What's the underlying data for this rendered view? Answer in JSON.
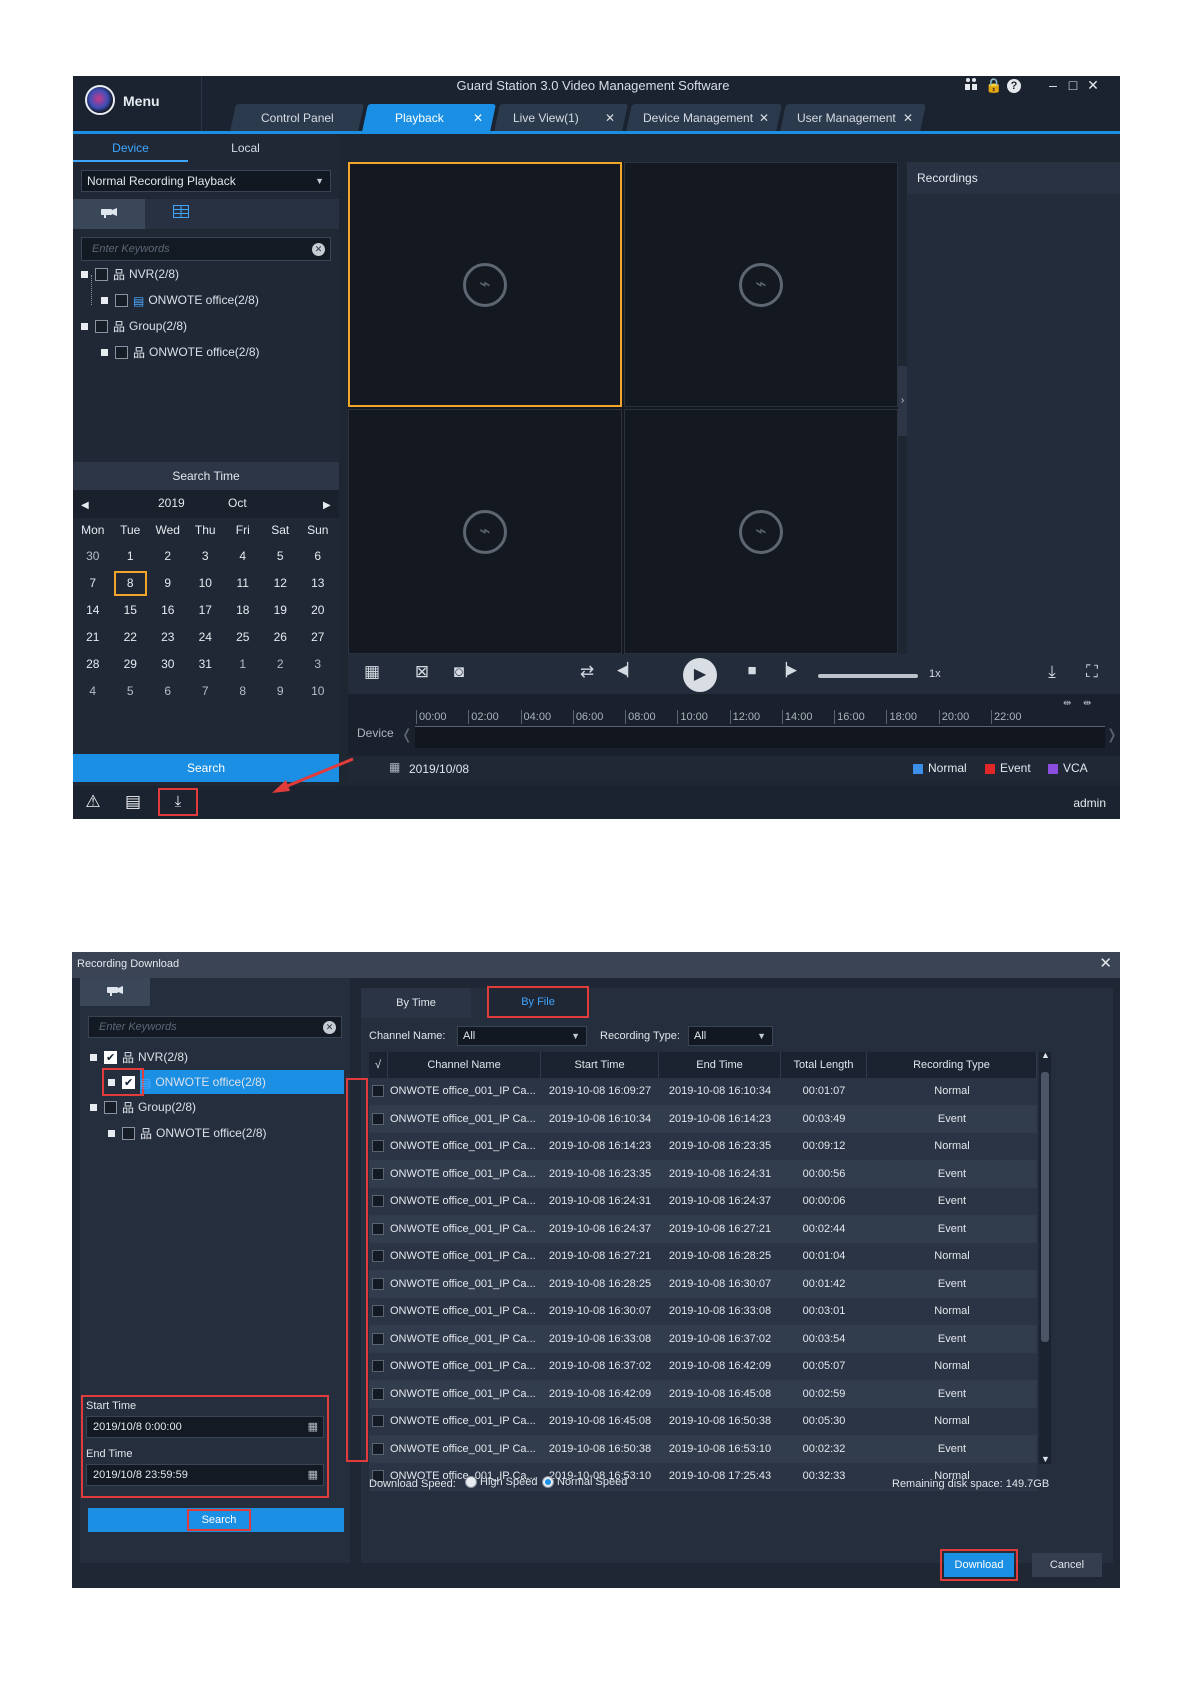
{
  "window1": {
    "menu_label": "Menu",
    "app_title": "Guard Station 3.0 Video Management Software",
    "window_icons": [
      "user-switch-icon",
      "lock-icon",
      "help-icon",
      "minimize-icon",
      "maximize-icon",
      "close-icon"
    ],
    "window_glyphs": {
      "lock": "🔒",
      "help": "?",
      "minimize": "–",
      "maximize": "□",
      "close": "✕"
    },
    "tabs": [
      {
        "label": "Control Panel",
        "closable": false,
        "active": false
      },
      {
        "label": "Playback",
        "closable": true,
        "active": true
      },
      {
        "label": "Live View(1)",
        "closable": true,
        "active": false
      },
      {
        "label": "Device Management",
        "closable": true,
        "active": false
      },
      {
        "label": "User Management",
        "closable": true,
        "active": false
      }
    ],
    "tab_close_glyph": "✕",
    "subtabs": {
      "device": "Device",
      "local": "Local"
    },
    "playback_mode": "Normal Recording Playback",
    "search_placeholder": "Enter Keywords",
    "tree": [
      {
        "label": "NVR(2/8)",
        "level": 0
      },
      {
        "label": "ONWOTE office(2/8)",
        "level": 1
      },
      {
        "label": "Group(2/8)",
        "level": 0
      },
      {
        "label": "ONWOTE office(2/8)",
        "level": 1
      }
    ],
    "search_time_label": "Search Time",
    "calendar": {
      "year": "2019",
      "month": "Oct",
      "weekdays": [
        "Mon",
        "Tue",
        "Wed",
        "Thu",
        "Fri",
        "Sat",
        "Sun"
      ],
      "days": [
        [
          "30",
          "1",
          "2",
          "3",
          "4",
          "5",
          "6"
        ],
        [
          "7",
          "8",
          "9",
          "10",
          "11",
          "12",
          "13"
        ],
        [
          "14",
          "15",
          "16",
          "17",
          "18",
          "19",
          "20"
        ],
        [
          "21",
          "22",
          "23",
          "24",
          "25",
          "26",
          "27"
        ],
        [
          "28",
          "29",
          "30",
          "31",
          "1",
          "2",
          "3"
        ],
        [
          "4",
          "5",
          "6",
          "7",
          "8",
          "9",
          "10"
        ]
      ],
      "selected": "8"
    },
    "search_button": "Search",
    "recordings_title": "Recordings",
    "speed_label": "1x",
    "device_label": "Device",
    "timeline_ticks": [
      "00:00",
      "02:00",
      "04:00",
      "06:00",
      "08:00",
      "10:00",
      "12:00",
      "14:00",
      "16:00",
      "18:00",
      "20:00",
      "22:00"
    ],
    "date": "2019/10/08",
    "legend": [
      {
        "label": "Normal",
        "color": "#3b8fe8"
      },
      {
        "label": "Event",
        "color": "#e02828"
      },
      {
        "label": "VCA",
        "color": "#8a4de0"
      }
    ],
    "user": "admin",
    "accent_color": "#1a8fe3",
    "highlight_color": "#f2a52b"
  },
  "window2": {
    "title": "Recording Download",
    "close_glyph": "✕",
    "search_placeholder": "Enter Keywords",
    "tree": [
      {
        "label": "NVR(2/8)",
        "level": 0
      },
      {
        "label": "ONWOTE office(2/8)",
        "level": 1
      },
      {
        "label": "Group(2/8)",
        "level": 0
      },
      {
        "label": "ONWOTE office(2/8)",
        "level": 1
      }
    ],
    "start_time_label": "Start Time",
    "start_time_value": "2019/10/8 0:00:00",
    "end_time_label": "End Time",
    "end_time_value": "2019/10/8 23:59:59",
    "search_button": "Search",
    "tabs": {
      "by_time": "By Time",
      "by_file": "By File"
    },
    "channel_name_label": "Channel Name:",
    "channel_name_value": "All",
    "recording_type_label": "Recording Type:",
    "recording_type_value": "All",
    "columns": [
      "√",
      "Channel Name",
      "Start Time",
      "End Time",
      "Total Length",
      "Recording Type"
    ],
    "rows": [
      [
        "ONWOTE office_001_IP Ca...",
        "2019-10-08 16:09:27",
        "2019-10-08 16:10:34",
        "00:01:07",
        "Normal"
      ],
      [
        "ONWOTE office_001_IP Ca...",
        "2019-10-08 16:10:34",
        "2019-10-08 16:14:23",
        "00:03:49",
        "Event"
      ],
      [
        "ONWOTE office_001_IP Ca...",
        "2019-10-08 16:14:23",
        "2019-10-08 16:23:35",
        "00:09:12",
        "Normal"
      ],
      [
        "ONWOTE office_001_IP Ca...",
        "2019-10-08 16:23:35",
        "2019-10-08 16:24:31",
        "00:00:56",
        "Event"
      ],
      [
        "ONWOTE office_001_IP Ca...",
        "2019-10-08 16:24:31",
        "2019-10-08 16:24:37",
        "00:00:06",
        "Event"
      ],
      [
        "ONWOTE office_001_IP Ca...",
        "2019-10-08 16:24:37",
        "2019-10-08 16:27:21",
        "00:02:44",
        "Event"
      ],
      [
        "ONWOTE office_001_IP Ca...",
        "2019-10-08 16:27:21",
        "2019-10-08 16:28:25",
        "00:01:04",
        "Normal"
      ],
      [
        "ONWOTE office_001_IP Ca...",
        "2019-10-08 16:28:25",
        "2019-10-08 16:30:07",
        "00:01:42",
        "Event"
      ],
      [
        "ONWOTE office_001_IP Ca...",
        "2019-10-08 16:30:07",
        "2019-10-08 16:33:08",
        "00:03:01",
        "Normal"
      ],
      [
        "ONWOTE office_001_IP Ca...",
        "2019-10-08 16:33:08",
        "2019-10-08 16:37:02",
        "00:03:54",
        "Event"
      ],
      [
        "ONWOTE office_001_IP Ca...",
        "2019-10-08 16:37:02",
        "2019-10-08 16:42:09",
        "00:05:07",
        "Normal"
      ],
      [
        "ONWOTE office_001_IP Ca...",
        "2019-10-08 16:42:09",
        "2019-10-08 16:45:08",
        "00:02:59",
        "Event"
      ],
      [
        "ONWOTE office_001_IP Ca...",
        "2019-10-08 16:45:08",
        "2019-10-08 16:50:38",
        "00:05:30",
        "Normal"
      ],
      [
        "ONWOTE office_001_IP Ca...",
        "2019-10-08 16:50:38",
        "2019-10-08 16:53:10",
        "00:02:32",
        "Event"
      ],
      [
        "ONWOTE office_001_IP Ca...",
        "2019-10-08 16:53:10",
        "2019-10-08 17:25:43",
        "00:32:33",
        "Normal"
      ]
    ],
    "download_speed_label": "Download Speed:",
    "high_speed_label": "High Speed",
    "normal_speed_label": "Normal Speed",
    "selected_speed": "Normal Speed",
    "remaining_label": "Remaining disk space:",
    "remaining_value": "149.7GB",
    "download_button": "Download",
    "cancel_button": "Cancel",
    "annotation_color": "#e23b3b"
  }
}
